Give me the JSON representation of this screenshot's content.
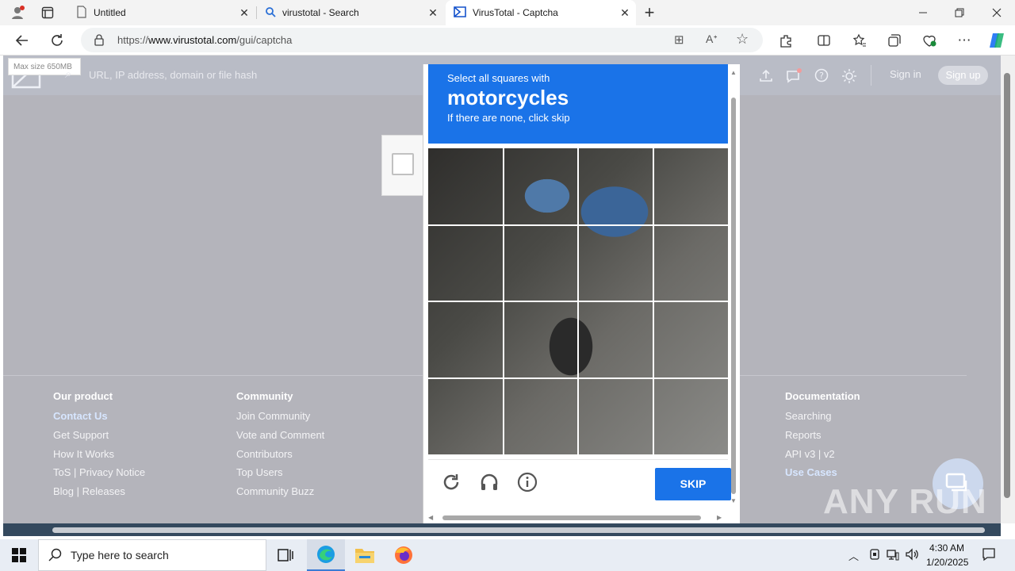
{
  "browser": {
    "tabs": [
      {
        "label": "Untitled",
        "icon": "page-icon"
      },
      {
        "label": "virustotal - Search",
        "icon": "search-icon"
      },
      {
        "label": "VirusTotal - Captcha",
        "icon": "virustotal-logo-icon",
        "active": true
      }
    ],
    "url": {
      "prefix": "https://",
      "domain": "www.virustotal.com",
      "path": "/gui/captcha"
    }
  },
  "virustotal": {
    "max_size": "Max size 650MB",
    "search_placeholder": "URL, IP address, domain or file hash",
    "sign_in": "Sign in",
    "sign_up": "Sign up"
  },
  "captcha": {
    "line1": "Select all squares with",
    "target": "motorcycles",
    "line3": "If there are none, click skip",
    "skip_label": "SKIP",
    "grid_rows": 4,
    "grid_cols": 4
  },
  "footer": {
    "our_product": {
      "heading": "Our product",
      "links": [
        "Contact Us",
        "Get Support",
        "How It Works",
        "ToS | Privacy Notice",
        "Blog | Releases"
      ]
    },
    "community": {
      "heading": "Community",
      "links": [
        "Join Community",
        "Vote and Comment",
        "Contributors",
        "Top Users",
        "Community Buzz"
      ]
    },
    "documentation": {
      "heading": "Documentation",
      "links": [
        "Searching",
        "Reports",
        "API v3 | v2",
        "Use Cases"
      ]
    }
  },
  "watermark": "ANY RUN",
  "taskbar": {
    "search_text": "Type here to search",
    "time": "4:30 AM",
    "date": "1/20/2025"
  }
}
